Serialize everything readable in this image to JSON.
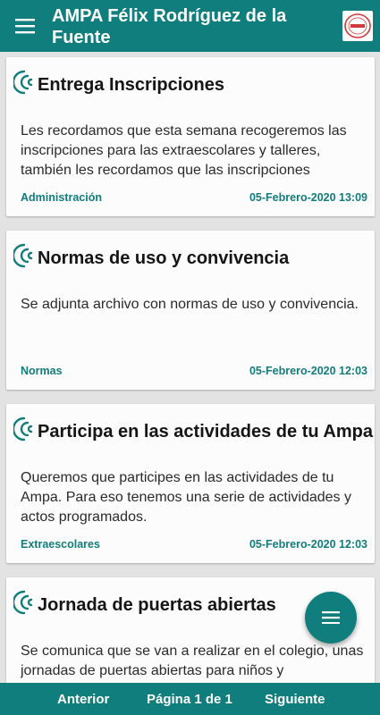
{
  "app": {
    "title": "AMPA Félix Rodríguez de la Fuente",
    "menu_icon": "hamburger-menu-icon",
    "logo_icon": "ampa-logo",
    "colors": {
      "primary": "#107e7d",
      "accent_text": "#127c7b",
      "background": "#e3e3e3",
      "card": "#fcfcfc"
    }
  },
  "posts": [
    {
      "title": "Entrega Inscripciones",
      "body": "Les recordamos que esta semana recogeremos las inscripciones para las extraescolares y talleres, también les recordamos que las inscripciones",
      "category": "Administración",
      "date": "05-Febrero-2020 13:09"
    },
    {
      "title": "Normas de uso y convivencia",
      "body": "Se adjunta archivo con normas de uso y convivencia.",
      "category": "Normas",
      "date": "05-Febrero-2020 12:03"
    },
    {
      "title": "Participa en las actividades de tu Ampa",
      "body": "Queremos que participes en las actividades de tu Ampa. Para eso tenemos una serie de actividades y actos programados.",
      "category": "Extraescolares",
      "date": "05-Febrero-2020 12:03"
    },
    {
      "title": "Jornada de puertas abiertas",
      "body": "Se comunica que se van a realizar en el colegio, unas jornadas de puertas abiertas para niños y",
      "category": "",
      "date": ""
    }
  ],
  "fab": {
    "icon": "menu-lines-icon"
  },
  "pager": {
    "prev": "Anterior",
    "page": "Página 1 de 1",
    "next": "Siguiente"
  }
}
